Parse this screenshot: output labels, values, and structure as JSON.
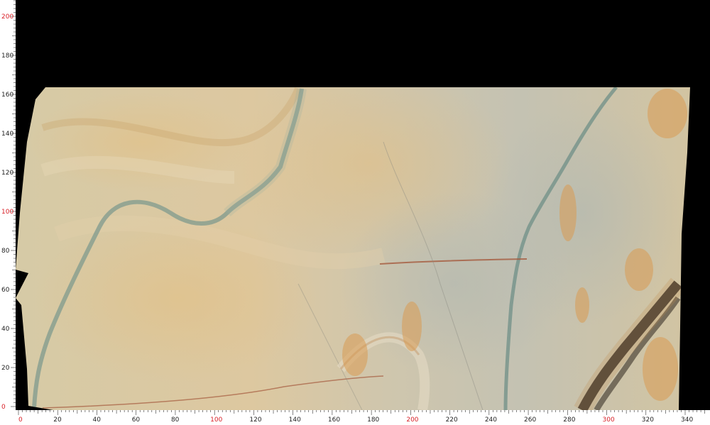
{
  "image": {
    "subject": "stone slab",
    "colors": {
      "background": "#000000",
      "ruler": "#ffffff",
      "ruler_text": "#222222",
      "ruler_major_text": "#d81f26",
      "slab_base": "#d8c9a8",
      "slab_warm": "#dcc08a",
      "slab_cool": "#b9bcb2",
      "vein_green": "#7f9a8e",
      "vein_rust": "#a55a3d",
      "vein_dark": "#2a2520",
      "rust_spots": "#d99a52"
    }
  },
  "ruler": {
    "x_labels": [
      "0",
      "20",
      "40",
      "60",
      "80",
      "100",
      "120",
      "140",
      "160",
      "180",
      "200",
      "220",
      "240",
      "260",
      "280",
      "300",
      "320",
      "340"
    ],
    "y_labels": [
      "200",
      "180",
      "160",
      "140",
      "120",
      "100",
      "80",
      "60",
      "40",
      "20",
      "0"
    ],
    "x_major": [
      "0",
      "100",
      "200",
      "300"
    ],
    "y_major": [
      "200",
      "100",
      "0"
    ]
  }
}
